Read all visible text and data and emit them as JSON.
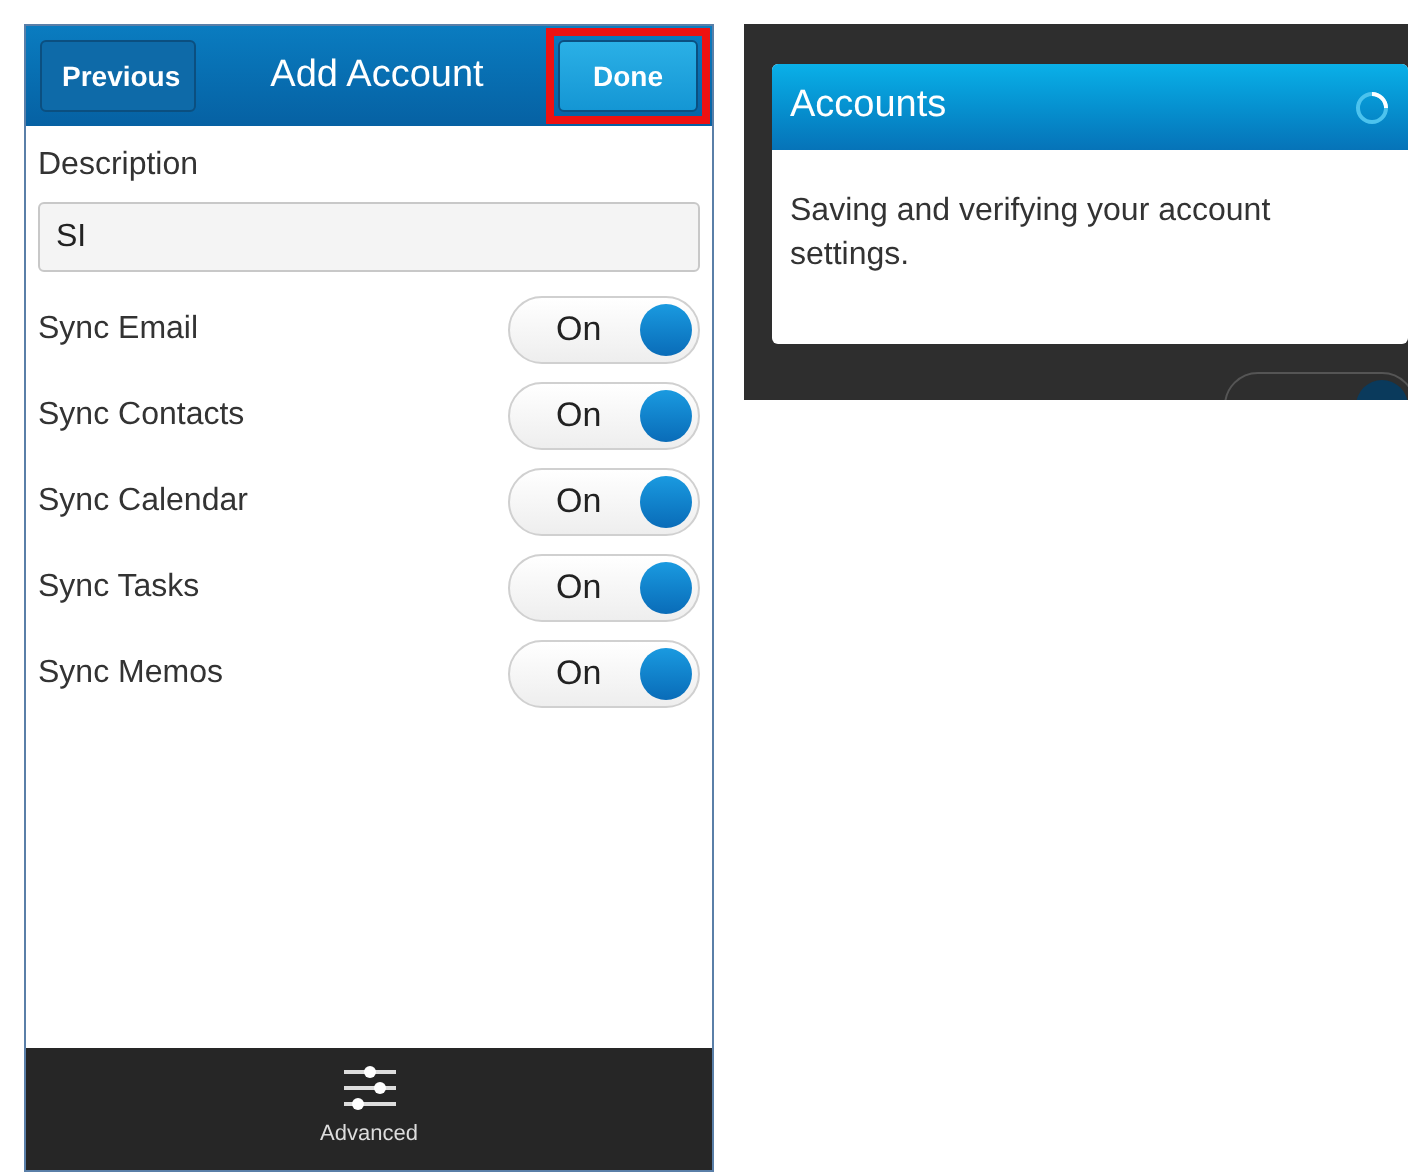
{
  "add_account": {
    "title": "Add Account",
    "buttons": [
      {
        "label": "Previous",
        "highlighted": false
      },
      {
        "label": "Done",
        "highlighted": true
      }
    ],
    "description": {
      "label": "Description",
      "value": "SI"
    },
    "toggles": [
      {
        "label": "Sync Email",
        "state": "On",
        "on": true
      },
      {
        "label": "Sync Contacts",
        "state": "On",
        "on": true
      },
      {
        "label": "Sync Calendar",
        "state": "On",
        "on": true
      },
      {
        "label": "Sync Tasks",
        "state": "On",
        "on": true
      },
      {
        "label": "Sync Memos",
        "state": "On",
        "on": true
      }
    ],
    "action_bar": {
      "label": "Advanced"
    }
  },
  "saving": {
    "dialog": {
      "title": "Accounts",
      "message": "Saving and verifying your account settings."
    }
  }
}
